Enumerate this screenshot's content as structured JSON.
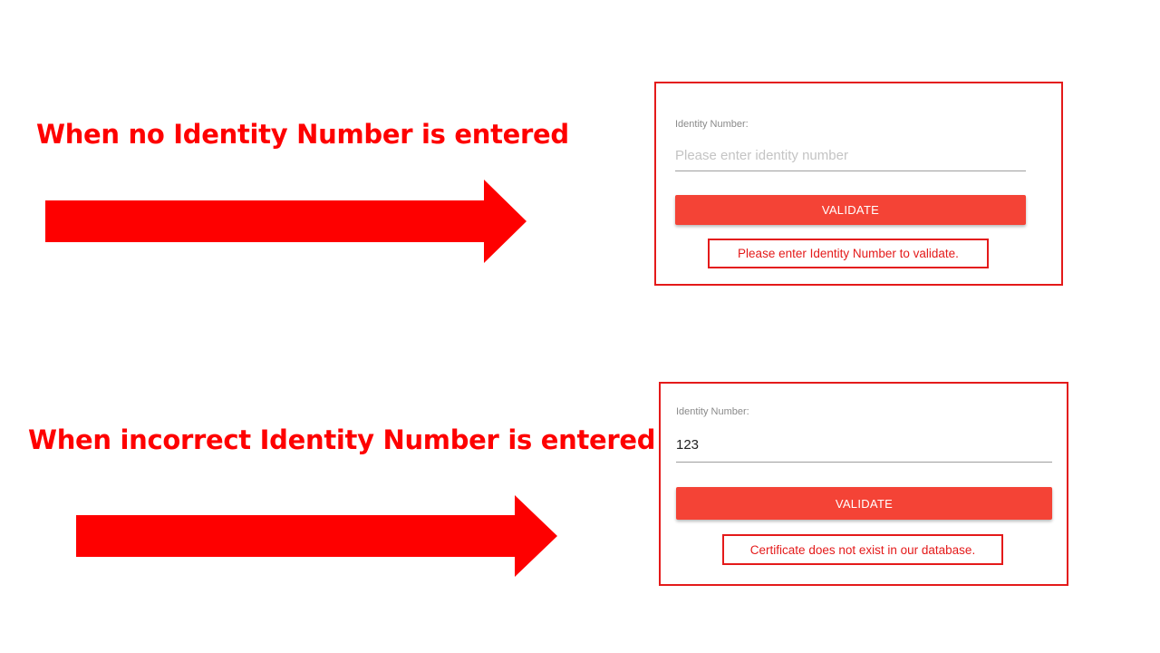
{
  "scenario_1": {
    "heading": "When no Identity Number is entered",
    "form": {
      "field_label": "Identity Number:",
      "input_value": "",
      "input_placeholder": "Please enter identity number",
      "button_label": "VALIDATE",
      "error_message": "Please enter Identity Number to validate."
    }
  },
  "scenario_2": {
    "heading": "When incorrect Identity Number is entered",
    "form": {
      "field_label": "Identity Number:",
      "input_value": "123",
      "input_placeholder": "",
      "button_label": "VALIDATE",
      "error_message": "Certificate does not exist in our database."
    }
  },
  "icons": {
    "arrow": "right-arrow-icon"
  },
  "colors": {
    "heading": "#fe0000",
    "arrow": "#fe0000",
    "highlight_border": "#e41a1a",
    "button": "#f44336",
    "error_text": "#e41a1a"
  }
}
